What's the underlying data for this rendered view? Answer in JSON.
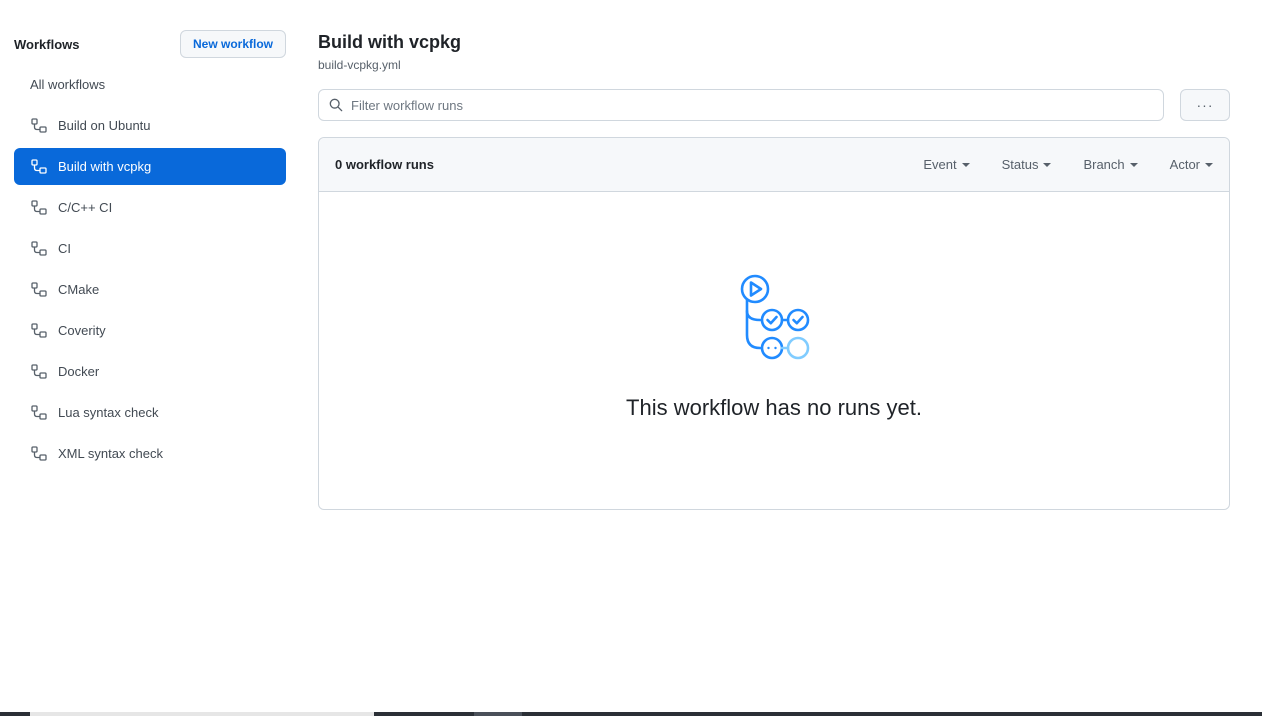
{
  "sidebar": {
    "title": "Workflows",
    "new_workflow_label": "New workflow",
    "all_workflows_label": "All workflows",
    "items": [
      {
        "label": "Build on Ubuntu",
        "active": false
      },
      {
        "label": "Build with vcpkg",
        "active": true
      },
      {
        "label": "C/C++ CI",
        "active": false
      },
      {
        "label": "CI",
        "active": false
      },
      {
        "label": "CMake",
        "active": false
      },
      {
        "label": "Coverity",
        "active": false
      },
      {
        "label": "Docker",
        "active": false
      },
      {
        "label": "Lua syntax check",
        "active": false
      },
      {
        "label": "XML syntax check",
        "active": false
      }
    ]
  },
  "main": {
    "title": "Build with vcpkg",
    "filename": "build-vcpkg.yml",
    "filter_placeholder": "Filter workflow runs",
    "more_label": "···",
    "runs_count": "0 workflow runs",
    "filters": [
      "Event",
      "Status",
      "Branch",
      "Actor"
    ],
    "empty_message": "This workflow has no runs yet."
  },
  "colors": {
    "accent": "#0969da",
    "illustration_blue": "#218bff",
    "illustration_light": "#80ccff"
  },
  "icons": {
    "workflow": "workflow-icon",
    "search": "search-icon",
    "more": "kebab-horizontal-icon",
    "caret": "triangle-down-icon"
  }
}
